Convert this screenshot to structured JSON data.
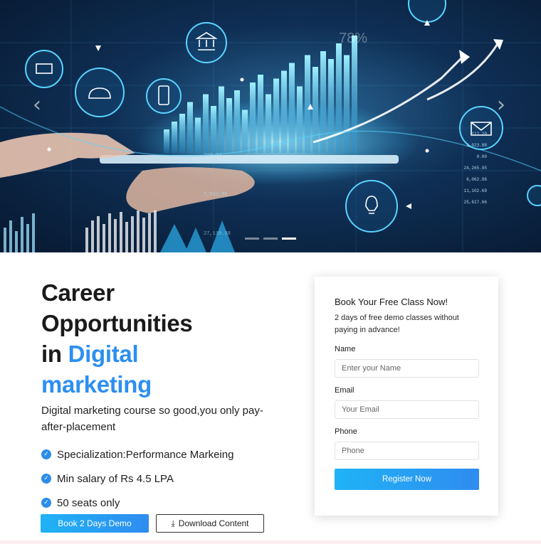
{
  "hero": {
    "image_description_icon_names": [
      "laptop-icon",
      "cloud-transfer-icon",
      "tablet-icon",
      "bank-icon",
      "mail-icon",
      "lightbulb-icon"
    ],
    "overlay_percent": "78%",
    "ticker_values": [
      "112.29",
      "1,023.88",
      "0.00",
      "24,265.95",
      "6,062.96",
      "11,102.69",
      "25,627.66"
    ],
    "chart_numbers": [
      "210.24",
      "7,513.08",
      "27,110.58"
    ],
    "slide_count": 3,
    "active_slide": 3,
    "colors": {
      "bg_dark": "#07182f",
      "glow": "#35c9ff"
    }
  },
  "content": {
    "headline_line1": "Career",
    "headline_line2": "Opportunities",
    "headline_line3_prefix": "in",
    "headline_accent_1": "Digital",
    "headline_accent_2": "marketing",
    "subtext": "Digital marketing course so good,you only pay-after-placement",
    "features": [
      "Specialization:Performance Markeing",
      "Min salary of Rs 4.5 LPA",
      "50 seats only"
    ],
    "primary_button": "Book 2 Days Demo",
    "secondary_button": "Download Content"
  },
  "form": {
    "title": "Book Your Free Class Now!",
    "subtitle": "2 days of free demo classes without paying in advance!",
    "name_label": "Name",
    "name_placeholder": "Enter your Name",
    "email_label": "Email",
    "email_placeholder": "Your Email",
    "phone_label": "Phone",
    "phone_placeholder": "Phone",
    "submit": "Register Now"
  },
  "colors": {
    "accent": "#2d8ff0",
    "button_gradient_start": "#1fb3f5",
    "button_gradient_end": "#2f8cf0",
    "check_color": "#2b8de8"
  }
}
